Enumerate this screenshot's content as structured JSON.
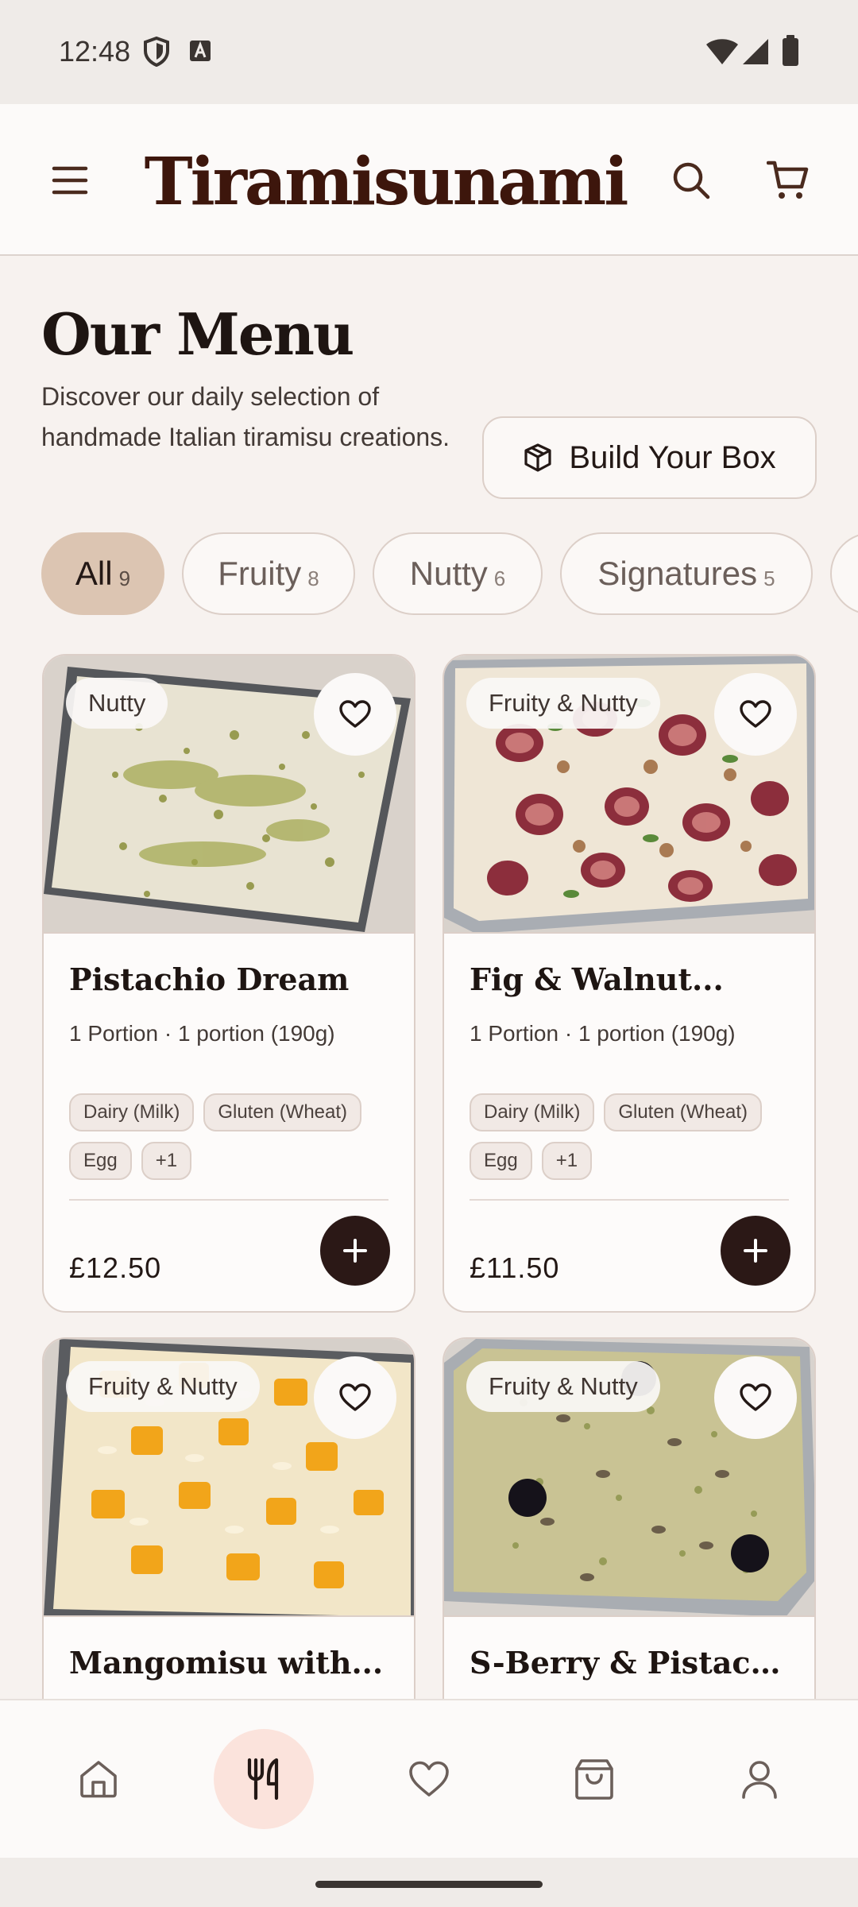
{
  "status": {
    "time": "12:48"
  },
  "header": {
    "logo_text": "Tiramisunami"
  },
  "page": {
    "title": "Our Menu",
    "description": "Discover our daily selection of handmade Italian tiramisu creations.",
    "build_box_label": "Build Your Box"
  },
  "filters": [
    {
      "label": "All",
      "count": "9",
      "active": true
    },
    {
      "label": "Fruity",
      "count": "8",
      "active": false
    },
    {
      "label": "Nutty",
      "count": "6",
      "active": false
    },
    {
      "label": "Signatures",
      "count": "5",
      "active": false
    }
  ],
  "products": [
    {
      "badge": "Nutty",
      "name": "Pistachio Dream",
      "subtitle": "1 Portion · 1 portion (190g)",
      "tags": [
        "Dairy (Milk)",
        "Gluten (Wheat)",
        "Egg",
        "+1"
      ],
      "price": "£12.50"
    },
    {
      "badge": "Fruity & Nutty",
      "name": "Fig & Walnut...",
      "subtitle": "1 Portion · 1 portion (190g)",
      "tags": [
        "Dairy (Milk)",
        "Gluten (Wheat)",
        "Egg",
        "+1"
      ],
      "price": "£11.50"
    },
    {
      "badge": "Fruity & Nutty",
      "name": "Mangomisu with..."
    },
    {
      "badge": "Fruity & Nutty",
      "name": "S-Berry & Pistachio..."
    }
  ],
  "bottom_nav": [
    {
      "icon": "home-icon",
      "active": false
    },
    {
      "icon": "menu-utensils-icon",
      "active": true
    },
    {
      "icon": "favorites-heart-icon",
      "active": false
    },
    {
      "icon": "bag-icon",
      "active": false
    },
    {
      "icon": "profile-icon",
      "active": false
    }
  ],
  "colors": {
    "accent": "#2b1816",
    "chip_active": "#dcc5b2",
    "nav_active": "#fbe3dc",
    "logo": "#3d160c"
  }
}
